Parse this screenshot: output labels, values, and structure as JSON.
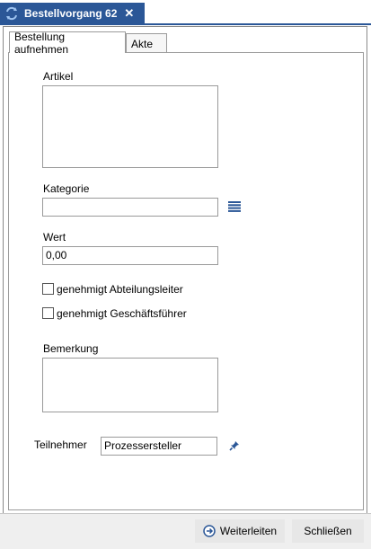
{
  "window": {
    "title": "Bestellvorgang 62",
    "close_glyph": "✕",
    "accent": "#2b5797"
  },
  "tabs": [
    {
      "label": "Bestellung aufnehmen",
      "active": true
    },
    {
      "label": "Akte",
      "active": false
    }
  ],
  "form": {
    "artikel_label": "Artikel",
    "artikel_value": "",
    "kategorie_label": "Kategorie",
    "kategorie_value": "",
    "wert_label": "Wert",
    "wert_value": "0,00",
    "checkbox1_label": "genehmigt Abteilungsleiter",
    "checkbox1_checked": false,
    "checkbox2_label": "genehmigt Geschäftsführer",
    "checkbox2_checked": false,
    "bemerkung_label": "Bemerkung",
    "bemerkung_value": "",
    "teilnehmer_label": "Teilnehmer",
    "teilnehmer_value": "Prozessersteller"
  },
  "footer": {
    "forward_label": "Weiterleiten",
    "close_label": "Schließen"
  }
}
